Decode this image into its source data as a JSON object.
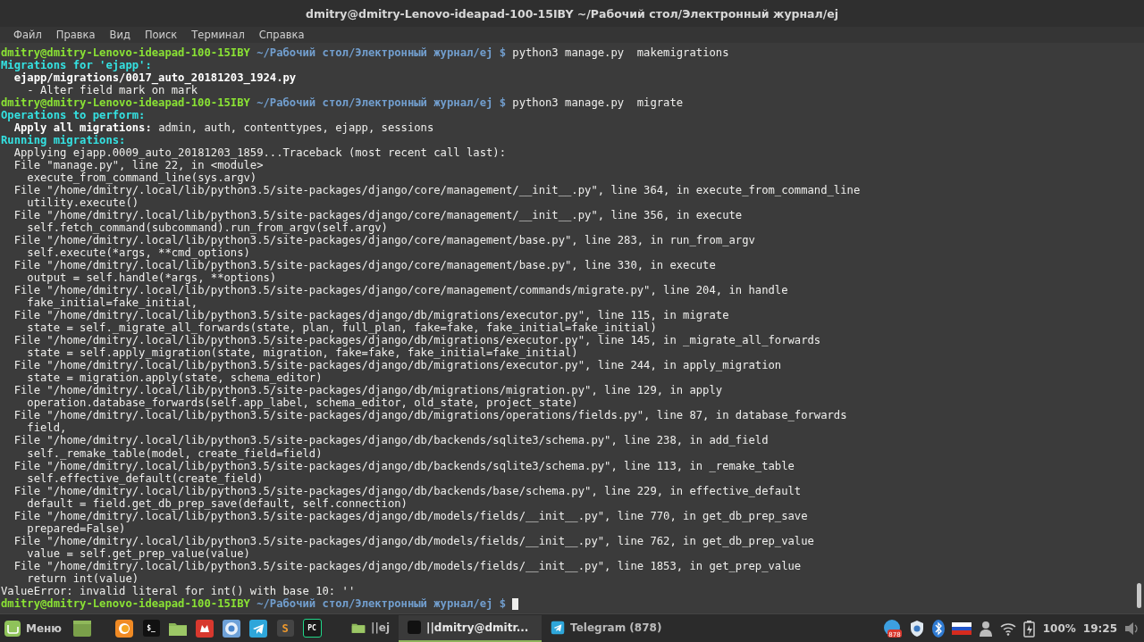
{
  "window": {
    "title": "dmitry@dmitry-Lenovo-ideapad-100-15IBY ~/Рабочий стол/Электронный журнал/ej"
  },
  "menu": [
    "Файл",
    "Правка",
    "Вид",
    "Поиск",
    "Терминал",
    "Справка"
  ],
  "terminal": {
    "lines": [
      {
        "segments": [
          {
            "kind": "user",
            "text": "dmitry@dmitry-Lenovo-ideapad-100-15IBY"
          },
          {
            "kind": "path",
            "text": " ~/Рабочий стол/Электронный журнал/ej $"
          },
          {
            "kind": "plain",
            "text": " python3 manage.py  makemigrations"
          }
        ]
      },
      {
        "segments": [
          {
            "kind": "head",
            "text": "Migrations for 'ejapp':"
          }
        ]
      },
      {
        "segments": [
          {
            "kind": "bold",
            "text": "  ejapp/migrations/0017_auto_20181203_1924.py"
          }
        ]
      },
      {
        "segments": [
          {
            "kind": "plain",
            "text": "    - Alter field mark on mark"
          }
        ]
      },
      {
        "segments": [
          {
            "kind": "user",
            "text": "dmitry@dmitry-Lenovo-ideapad-100-15IBY"
          },
          {
            "kind": "path",
            "text": " ~/Рабочий стол/Электронный журнал/ej $"
          },
          {
            "kind": "plain",
            "text": " python3 manage.py  migrate"
          }
        ]
      },
      {
        "segments": [
          {
            "kind": "head",
            "text": "Operations to perform:"
          }
        ]
      },
      {
        "segments": [
          {
            "kind": "bold",
            "text": "  Apply all migrations:"
          },
          {
            "kind": "plain",
            "text": " admin, auth, contenttypes, ejapp, sessions"
          }
        ]
      },
      {
        "segments": [
          {
            "kind": "head",
            "text": "Running migrations:"
          }
        ]
      },
      {
        "segments": [
          {
            "kind": "plain",
            "text": "  Applying ejapp.0009_auto_20181203_1859...Traceback (most recent call last):"
          }
        ]
      },
      {
        "segments": [
          {
            "kind": "plain",
            "text": "  File \"manage.py\", line 22, in <module>"
          }
        ]
      },
      {
        "segments": [
          {
            "kind": "plain",
            "text": "    execute_from_command_line(sys.argv)"
          }
        ]
      },
      {
        "segments": [
          {
            "kind": "plain",
            "text": "  File \"/home/dmitry/.local/lib/python3.5/site-packages/django/core/management/__init__.py\", line 364, in execute_from_command_line"
          }
        ]
      },
      {
        "segments": [
          {
            "kind": "plain",
            "text": "    utility.execute()"
          }
        ]
      },
      {
        "segments": [
          {
            "kind": "plain",
            "text": "  File \"/home/dmitry/.local/lib/python3.5/site-packages/django/core/management/__init__.py\", line 356, in execute"
          }
        ]
      },
      {
        "segments": [
          {
            "kind": "plain",
            "text": "    self.fetch_command(subcommand).run_from_argv(self.argv)"
          }
        ]
      },
      {
        "segments": [
          {
            "kind": "plain",
            "text": "  File \"/home/dmitry/.local/lib/python3.5/site-packages/django/core/management/base.py\", line 283, in run_from_argv"
          }
        ]
      },
      {
        "segments": [
          {
            "kind": "plain",
            "text": "    self.execute(*args, **cmd_options)"
          }
        ]
      },
      {
        "segments": [
          {
            "kind": "plain",
            "text": "  File \"/home/dmitry/.local/lib/python3.5/site-packages/django/core/management/base.py\", line 330, in execute"
          }
        ]
      },
      {
        "segments": [
          {
            "kind": "plain",
            "text": "    output = self.handle(*args, **options)"
          }
        ]
      },
      {
        "segments": [
          {
            "kind": "plain",
            "text": "  File \"/home/dmitry/.local/lib/python3.5/site-packages/django/core/management/commands/migrate.py\", line 204, in handle"
          }
        ]
      },
      {
        "segments": [
          {
            "kind": "plain",
            "text": "    fake_initial=fake_initial,"
          }
        ]
      },
      {
        "segments": [
          {
            "kind": "plain",
            "text": "  File \"/home/dmitry/.local/lib/python3.5/site-packages/django/db/migrations/executor.py\", line 115, in migrate"
          }
        ]
      },
      {
        "segments": [
          {
            "kind": "plain",
            "text": "    state = self._migrate_all_forwards(state, plan, full_plan, fake=fake, fake_initial=fake_initial)"
          }
        ]
      },
      {
        "segments": [
          {
            "kind": "plain",
            "text": "  File \"/home/dmitry/.local/lib/python3.5/site-packages/django/db/migrations/executor.py\", line 145, in _migrate_all_forwards"
          }
        ]
      },
      {
        "segments": [
          {
            "kind": "plain",
            "text": "    state = self.apply_migration(state, migration, fake=fake, fake_initial=fake_initial)"
          }
        ]
      },
      {
        "segments": [
          {
            "kind": "plain",
            "text": "  File \"/home/dmitry/.local/lib/python3.5/site-packages/django/db/migrations/executor.py\", line 244, in apply_migration"
          }
        ]
      },
      {
        "segments": [
          {
            "kind": "plain",
            "text": "    state = migration.apply(state, schema_editor)"
          }
        ]
      },
      {
        "segments": [
          {
            "kind": "plain",
            "text": "  File \"/home/dmitry/.local/lib/python3.5/site-packages/django/db/migrations/migration.py\", line 129, in apply"
          }
        ]
      },
      {
        "segments": [
          {
            "kind": "plain",
            "text": "    operation.database_forwards(self.app_label, schema_editor, old_state, project_state)"
          }
        ]
      },
      {
        "segments": [
          {
            "kind": "plain",
            "text": "  File \"/home/dmitry/.local/lib/python3.5/site-packages/django/db/migrations/operations/fields.py\", line 87, in database_forwards"
          }
        ]
      },
      {
        "segments": [
          {
            "kind": "plain",
            "text": "    field,"
          }
        ]
      },
      {
        "segments": [
          {
            "kind": "plain",
            "text": "  File \"/home/dmitry/.local/lib/python3.5/site-packages/django/db/backends/sqlite3/schema.py\", line 238, in add_field"
          }
        ]
      },
      {
        "segments": [
          {
            "kind": "plain",
            "text": "    self._remake_table(model, create_field=field)"
          }
        ]
      },
      {
        "segments": [
          {
            "kind": "plain",
            "text": "  File \"/home/dmitry/.local/lib/python3.5/site-packages/django/db/backends/sqlite3/schema.py\", line 113, in _remake_table"
          }
        ]
      },
      {
        "segments": [
          {
            "kind": "plain",
            "text": "    self.effective_default(create_field)"
          }
        ]
      },
      {
        "segments": [
          {
            "kind": "plain",
            "text": "  File \"/home/dmitry/.local/lib/python3.5/site-packages/django/db/backends/base/schema.py\", line 229, in effective_default"
          }
        ]
      },
      {
        "segments": [
          {
            "kind": "plain",
            "text": "    default = field.get_db_prep_save(default, self.connection)"
          }
        ]
      },
      {
        "segments": [
          {
            "kind": "plain",
            "text": "  File \"/home/dmitry/.local/lib/python3.5/site-packages/django/db/models/fields/__init__.py\", line 770, in get_db_prep_save"
          }
        ]
      },
      {
        "segments": [
          {
            "kind": "plain",
            "text": "    prepared=False)"
          }
        ]
      },
      {
        "segments": [
          {
            "kind": "plain",
            "text": "  File \"/home/dmitry/.local/lib/python3.5/site-packages/django/db/models/fields/__init__.py\", line 762, in get_db_prep_value"
          }
        ]
      },
      {
        "segments": [
          {
            "kind": "plain",
            "text": "    value = self.get_prep_value(value)"
          }
        ]
      },
      {
        "segments": [
          {
            "kind": "plain",
            "text": "  File \"/home/dmitry/.local/lib/python3.5/site-packages/django/db/models/fields/__init__.py\", line 1853, in get_prep_value"
          }
        ]
      },
      {
        "segments": [
          {
            "kind": "plain",
            "text": "    return int(value)"
          }
        ]
      },
      {
        "segments": [
          {
            "kind": "plain",
            "text": "ValueError: invalid literal for int() with base 10: ''"
          }
        ]
      },
      {
        "segments": [
          {
            "kind": "user",
            "text": "dmitry@dmitry-Lenovo-ideapad-100-15IBY"
          },
          {
            "kind": "path",
            "text": " ~/Рабочий стол/Электронный журнал/ej $"
          }
        ],
        "cursor": true
      }
    ]
  },
  "taskbar": {
    "menu_button": {
      "label": "Меню"
    },
    "launchers": [
      {
        "kind": "desktop"
      },
      {
        "kind": "firefox"
      },
      {
        "kind": "terminal",
        "label": "$_"
      },
      {
        "kind": "folder"
      },
      {
        "kind": "redapp"
      },
      {
        "kind": "chromium"
      },
      {
        "kind": "telegram"
      },
      {
        "kind": "sublime",
        "label": "S"
      },
      {
        "kind": "pycharm",
        "label": "PC"
      }
    ],
    "windows": [
      {
        "kind": "folder",
        "label": "||ej",
        "selected": false
      },
      {
        "kind": "terminal",
        "label": "||dmitry@dmitr...",
        "selected": true
      },
      {
        "kind": "telegram",
        "label": "Telegram (878)",
        "selected": false
      }
    ],
    "tray": [
      {
        "kind": "telegram",
        "badge": "878"
      },
      {
        "kind": "shield"
      },
      {
        "kind": "bluetooth"
      },
      {
        "kind": "flag"
      },
      {
        "kind": "user"
      },
      {
        "kind": "wifi"
      },
      {
        "kind": "battery"
      }
    ],
    "battery": "100%",
    "clock": "19:25"
  }
}
